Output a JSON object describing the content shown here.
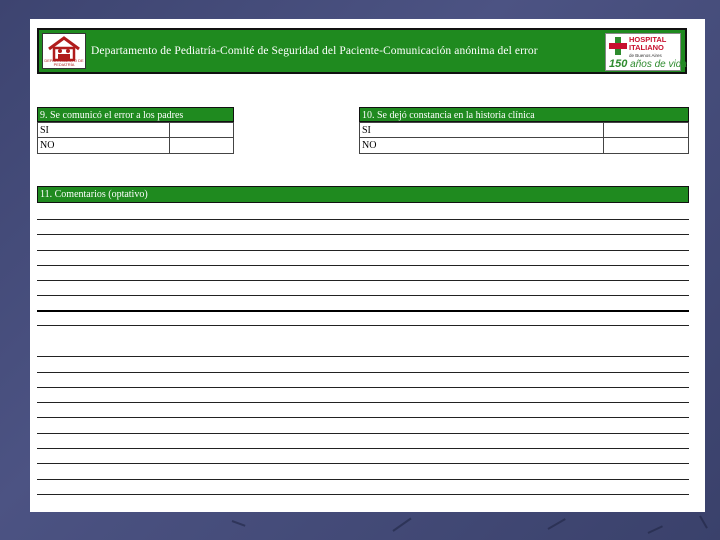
{
  "header": {
    "title": "Departamento de Pediatría-Comité de Seguridad del Paciente-Comunicación anónima del error",
    "dept_logo_caption": "DEPARTAMENTO DE PEDIATRÍA",
    "hospital_line1": "HOSPITAL",
    "hospital_line2": "ITALIANO",
    "hospital_line3": "de Buenos Aires",
    "hospital_years_number": "150",
    "hospital_years_text": "años de vida"
  },
  "question9": {
    "title": "9. Se comunicó el error a los padres",
    "options": [
      "SI",
      "NO"
    ]
  },
  "question10": {
    "title": "10. Se dejó constancia en la historia clínica",
    "options": [
      "SI",
      "NO"
    ]
  },
  "comments": {
    "title": "11. Comentarios (optativo)"
  },
  "colors": {
    "header_green": "#1f8a1f",
    "background": "#404774",
    "sheet": "#ffffff"
  }
}
